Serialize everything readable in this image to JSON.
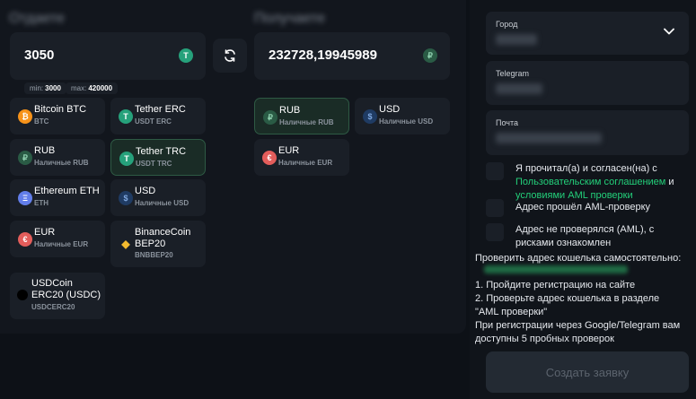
{
  "give": {
    "label": "Отдаете",
    "amount": "3050",
    "currency_icon": "T",
    "limits": {
      "min_label": "min:",
      "min": "3000",
      "max_label": "max:",
      "max": "420000"
    }
  },
  "receive": {
    "label": "Получаете",
    "amount": "232728,19945989",
    "currency_icon": "₽"
  },
  "give_currencies": [
    {
      "title": "Bitcoin BTC",
      "sub": "BTC",
      "icon": "₿",
      "color": "#f7931a"
    },
    {
      "title": "Tether ERC",
      "sub": "USDT ERC",
      "icon": "T",
      "color": "#26a17b"
    },
    {
      "title": "RUB",
      "sub": "Наличные RUB",
      "icon": "₽",
      "color": "#2a5b45"
    },
    {
      "title": "Tether TRC",
      "sub": "USDT TRC",
      "icon": "T",
      "color": "#26a17b"
    },
    {
      "title": "Ethereum ETH",
      "sub": "ETH",
      "icon": "Ξ",
      "color": "#627eea"
    },
    {
      "title": "USD",
      "sub": "Наличные USD",
      "icon": "$",
      "color": "#1f3b63"
    },
    {
      "title": "EUR",
      "sub": "Наличные EUR",
      "icon": "€",
      "color": "#e35d5b"
    },
    {
      "title_line1": "BinanceCoin",
      "title_line2": "BEP20",
      "sub": "BNBBEP20",
      "icon": "◆",
      "color": "#f3ba2f"
    },
    {
      "title_line1": "USDCoin",
      "title_line2": "ERC20 (USDC)",
      "sub": "USDCERC20",
      "icon": "●",
      "color": "#000000"
    }
  ],
  "receive_currencies": [
    {
      "title": "RUB",
      "sub": "Наличные RUB",
      "icon": "₽",
      "color": "#2a5b45"
    },
    {
      "title": "USD",
      "sub": "Наличные USD",
      "icon": "$",
      "color": "#1f3b63"
    },
    {
      "title": "EUR",
      "sub": "Наличные EUR",
      "icon": "€",
      "color": "#e35d5b"
    }
  ],
  "form": {
    "city_label": "Город",
    "telegram_label": "Telegram",
    "email_label": "Почта",
    "agree_text": "Я прочитал(а) и согласен(на) с",
    "agree_link1": "Пользовательским соглашением",
    "agree_and": " и",
    "agree_link2": "условиями AML проверки",
    "aml_passed": "Адрес прошёл AML-проверку",
    "aml_not_checked_line1": "Адрес не проверялся (AML), с",
    "aml_not_checked_line2": "рисками ознакомлен",
    "check_self_title": "Проверить адрес кошелька самостоятельно:",
    "step1": "1. Пройдите регистрацию на сайте",
    "step2_line1": "2. Проверьте адрес кошелька в разделе",
    "step2_line2": "\"AML проверки\"",
    "note_line1": "При регистрации через Google/Telegram вам",
    "note_line2": "доступны 5 пробных проверок",
    "submit_label": "Создать заявку"
  },
  "colors": {
    "accent_green": "#23d07a",
    "tether": "#26a17b",
    "bitcoin": "#f7931a"
  }
}
